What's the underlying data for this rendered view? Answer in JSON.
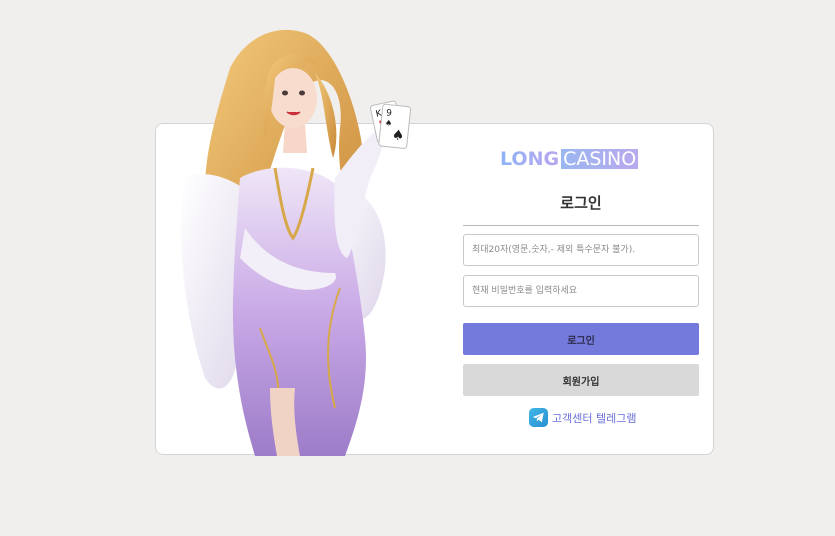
{
  "logo": {
    "part1": "LONG",
    "part2": "CASINO"
  },
  "login_title": "로그인",
  "username": {
    "placeholder": "최대20자(영문,숫자,- 제외 특수문자 불가)."
  },
  "password": {
    "placeholder": "현재 비밀번호를 입력하세요"
  },
  "buttons": {
    "login": "로그인",
    "signup": "회원가입"
  },
  "support_link": "고객센터 텔레그램",
  "colors": {
    "background": "#f0efed",
    "login_button": "#7479dc",
    "signup_button": "#d9d9d9",
    "support_link": "#6a6fd8"
  },
  "icons": {
    "support": "telegram-icon"
  }
}
